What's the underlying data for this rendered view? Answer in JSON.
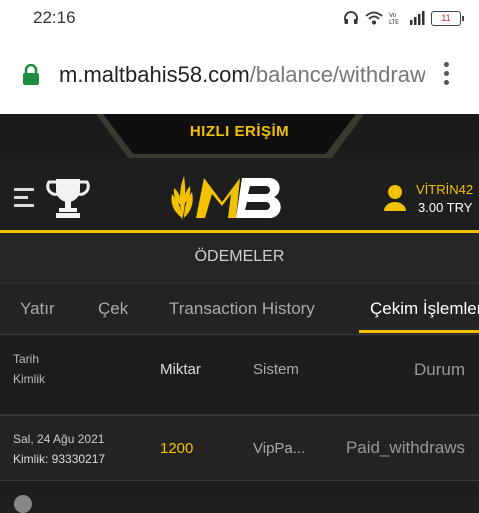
{
  "status_bar": {
    "time": "22:16",
    "battery": "11"
  },
  "browser": {
    "url_host": "m.maltbahis58.com",
    "url_path": "/balance/withdraws"
  },
  "quick_access": {
    "label": "HIZLI ERİŞİM"
  },
  "header": {
    "username": "VİTRİN42",
    "balance": "3.00 TRY"
  },
  "section": {
    "title": "ÖDEMELER"
  },
  "tabs": [
    {
      "label": "Yatır"
    },
    {
      "label": "Çek"
    },
    {
      "label": "Transaction History"
    },
    {
      "label": "Çekim İşlemleri",
      "active": true
    }
  ],
  "table": {
    "headers": {
      "date": "Tarih",
      "id": "Kimlik",
      "amount": "Miktar",
      "system": "Sistem",
      "status": "Durum"
    },
    "rows": [
      {
        "date": "Sal, 24 Ağu 2021",
        "id": "Kimlik: 93330217",
        "amount": "1200",
        "system": "VipPa...",
        "status": "Paid_withdraws"
      }
    ]
  },
  "colors": {
    "accent": "#f2c200",
    "background": "#1f1f1f"
  }
}
